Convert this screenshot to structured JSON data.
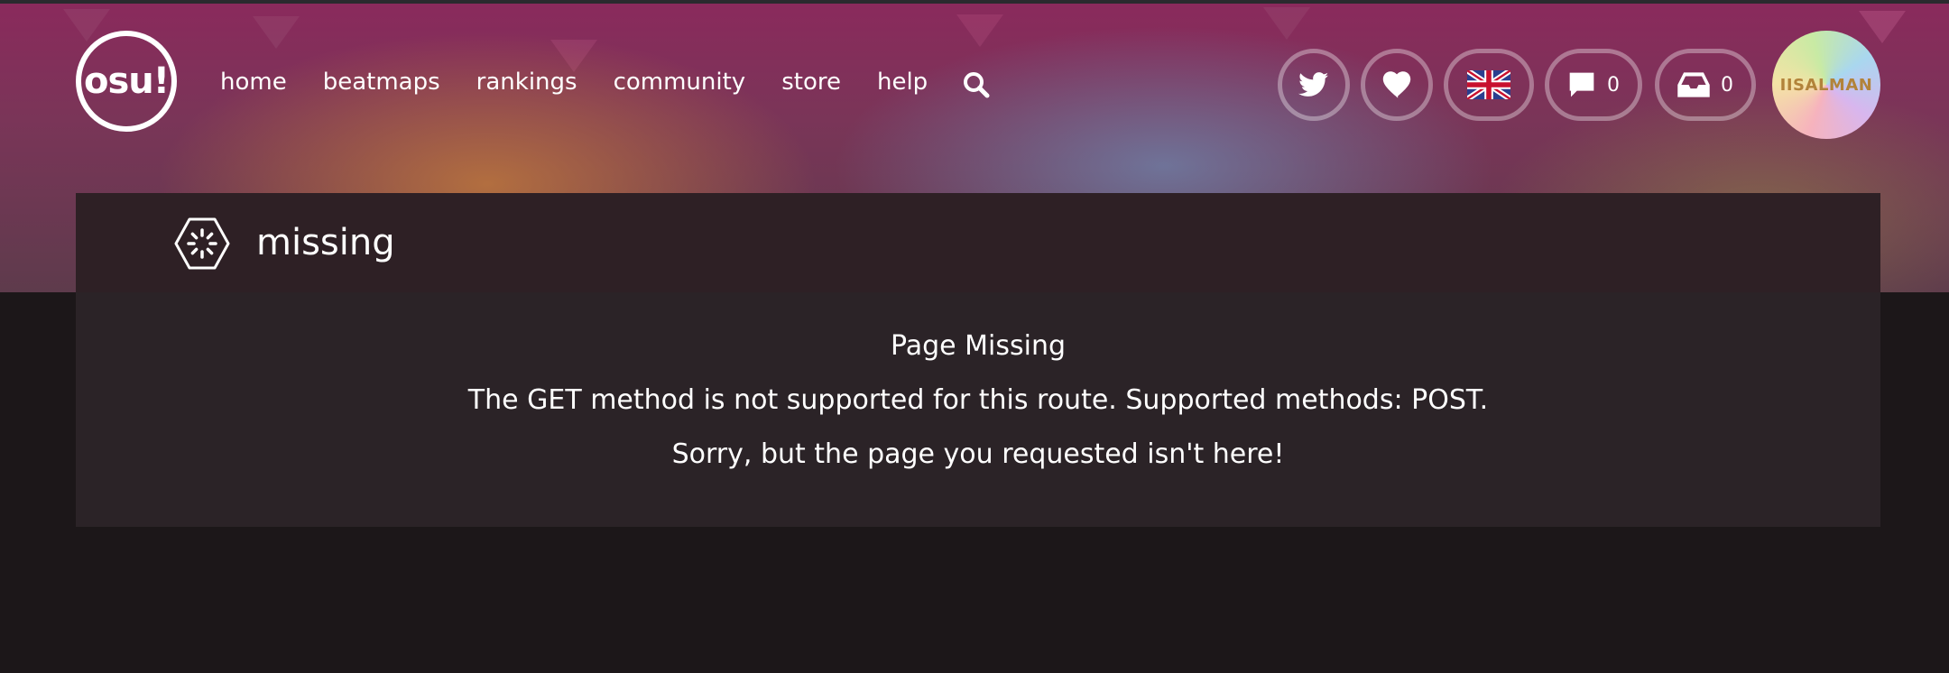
{
  "header": {
    "logo_text": "osu!",
    "nav": [
      {
        "label": "home"
      },
      {
        "label": "beatmaps"
      },
      {
        "label": "rankings"
      },
      {
        "label": "community"
      },
      {
        "label": "store"
      },
      {
        "label": "help"
      }
    ],
    "icons": {
      "search": "search-icon",
      "twitter": "twitter-icon",
      "support": "heart-icon",
      "language": "uk-flag-icon",
      "chat": "chat-icon",
      "notifications": "inbox-icon"
    },
    "chat_count": "0",
    "notification_count": "0",
    "avatar_text": "IISALMAN"
  },
  "page": {
    "title": "missing",
    "heading": "Page Missing",
    "message": "The GET method is not supported for this route. Supported methods: POST.",
    "apology": "Sorry, but the page you requested isn't here!"
  },
  "colors": {
    "background": "#1c1719",
    "card_header": "#2e2025",
    "card_body": "#2b2327",
    "banner_pink": "#8a2a5c"
  }
}
